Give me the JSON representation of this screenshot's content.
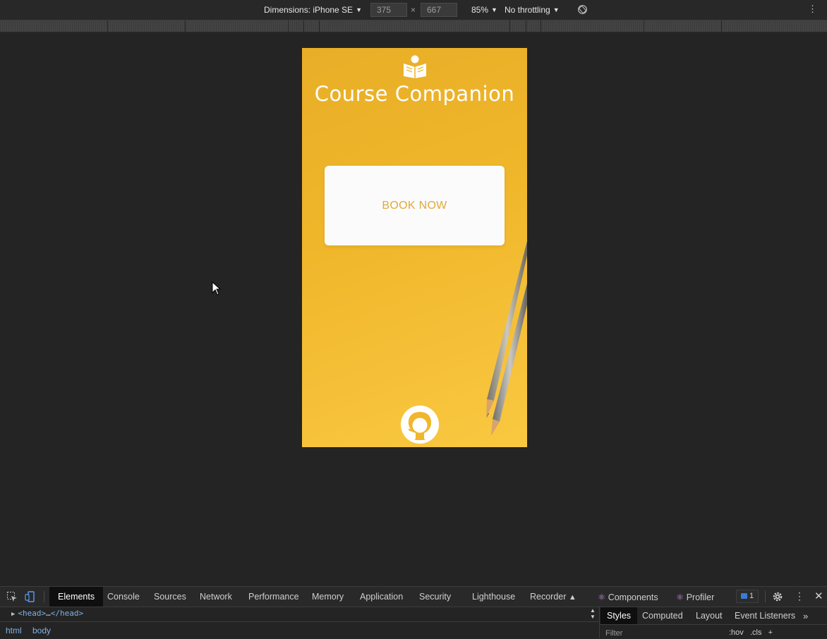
{
  "device_toolbar": {
    "dimensions_label": "Dimensions: iPhone SE",
    "width_value": "375",
    "height_value": "667",
    "times_symbol": "×",
    "zoom": "85%",
    "throttling": "No throttling"
  },
  "app": {
    "title": "Course Companion",
    "book_button_label": "BOOK NOW",
    "background_color": "#f0b72b",
    "button_text_color": "#e0a93a"
  },
  "devtools": {
    "tabs": [
      "Elements",
      "Console",
      "Sources",
      "Network",
      "Performance",
      "Memory",
      "Application",
      "Security",
      "Lighthouse",
      "Recorder"
    ],
    "active_tab": "Elements",
    "extension_tabs": [
      "Components",
      "Profiler"
    ],
    "issues_count": "1",
    "dom_line": {
      "open": "<head>",
      "ellipsis": "…",
      "close": "</head>"
    },
    "breadcrumbs": [
      "html",
      "body"
    ],
    "styles_tabs": [
      "Styles",
      "Computed",
      "Layout",
      "Event Listeners"
    ],
    "active_styles_tab": "Styles",
    "filter_placeholder": "Filter",
    "hov_label": ":hov",
    "cls_label": ".cls",
    "add_label": "+"
  },
  "icons": {
    "logo": "reading-book-icon",
    "footer": "github-icon",
    "rotate": "rotate-icon",
    "settings": "gear-icon"
  }
}
